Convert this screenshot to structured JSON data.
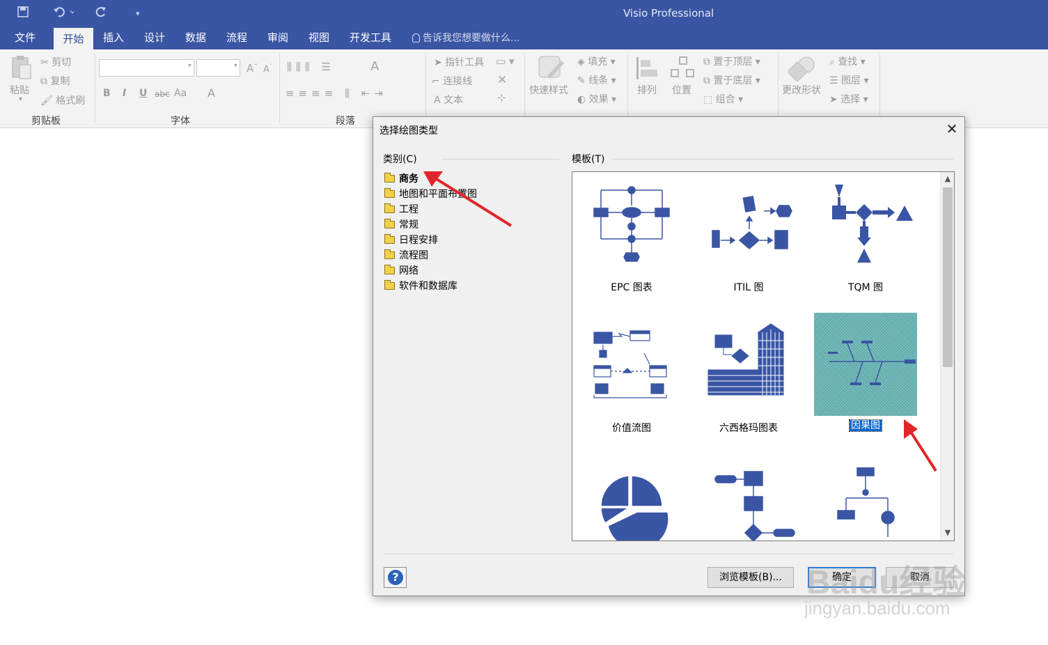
{
  "window": {
    "title": "Visio Professional",
    "quick_access": [
      "save-icon",
      "undo-icon",
      "redo-icon",
      "customize-qat-icon"
    ]
  },
  "ribbon_tabs": [
    "文件",
    "开始",
    "插入",
    "设计",
    "数据",
    "流程",
    "审阅",
    "视图",
    "开发工具"
  ],
  "active_tab": "开始",
  "tell_me": "告诉我您想要做什么...",
  "ribbon": {
    "clipboard": {
      "paste": "粘贴",
      "cut": "剪切",
      "copy": "复制",
      "format_painter": "格式刷",
      "group": "剪贴板"
    },
    "font": {
      "group": "字体",
      "bold": "B",
      "italic": "I",
      "underline": "U",
      "strike": "abc",
      "case": "Aa",
      "color": "A"
    },
    "paragraph": {
      "group": "段落"
    },
    "tools": {
      "pointer": "指针工具",
      "connector": "连接线",
      "text": "文本"
    },
    "shape_styles": {
      "quick_styles": "快速样式",
      "fill": "填充",
      "line": "线条",
      "effects": "效果"
    },
    "arrange": {
      "arrange": "排列",
      "position": "位置",
      "bring_front": "置于顶层",
      "send_back": "置于底层",
      "group": "组合"
    },
    "editing": {
      "change_shape": "更改形状",
      "find": "查找",
      "layers": "图层",
      "select": "选择"
    }
  },
  "dialog": {
    "title": "选择绘图类型",
    "categories_label": "类别(C)",
    "templates_label": "模板(T)",
    "categories": [
      "商务",
      "地图和平面布置图",
      "工程",
      "常规",
      "日程安排",
      "流程图",
      "网络",
      "软件和数据库"
    ],
    "selected_category": "商务",
    "templates": [
      {
        "label": "EPC 图表",
        "icon": "epc-diagram-icon"
      },
      {
        "label": "ITIL 图",
        "icon": "itil-diagram-icon"
      },
      {
        "label": "TQM 图",
        "icon": "tqm-diagram-icon"
      },
      {
        "label": "价值流图",
        "icon": "value-stream-map-icon"
      },
      {
        "label": "六西格玛图表",
        "icon": "six-sigma-diagram-icon"
      },
      {
        "label": "因果图",
        "icon": "cause-effect-diagram-icon"
      },
      {
        "label": "",
        "icon": "pie-chart-icon"
      },
      {
        "label": "",
        "icon": "flowchart-icon"
      },
      {
        "label": "",
        "icon": "org-chart-icon"
      }
    ],
    "selected_template": "因果图",
    "buttons": {
      "browse": "浏览模板(B)...",
      "ok": "确定",
      "cancel": "取消"
    }
  },
  "watermark": {
    "brand": "Baidu经验",
    "url": "jingyan.baidu.com"
  },
  "colors": {
    "title_bar": "#3955a3",
    "template_blue": "#3a55a4",
    "selection": "#0a64c8",
    "annotation_arrow": "#e0262b"
  }
}
